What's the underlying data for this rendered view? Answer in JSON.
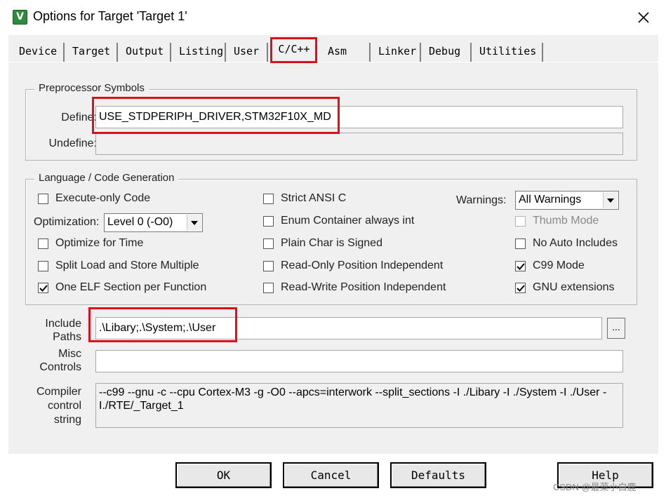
{
  "window": {
    "title": "Options for Target 'Target 1'",
    "icon_glyph": "V"
  },
  "tabs": [
    {
      "label": "Device"
    },
    {
      "label": "Target"
    },
    {
      "label": "Output"
    },
    {
      "label": "Listing"
    },
    {
      "label": "User"
    },
    {
      "label": "C/C++",
      "active": true
    },
    {
      "label": "Asm"
    },
    {
      "label": "Linker"
    },
    {
      "label": "Debug"
    },
    {
      "label": "Utilities"
    }
  ],
  "preprocessor": {
    "group_label": "Preprocessor Symbols",
    "define_label": "Define:",
    "define_value": "USE_STDPERIPH_DRIVER,STM32F10X_MD",
    "undefine_label": "Undefine:",
    "undefine_value": ""
  },
  "language": {
    "group_label": "Language / Code Generation",
    "execute_only": {
      "label": "Execute-only Code",
      "checked": false
    },
    "optimization_label": "Optimization:",
    "optimization_value": "Level 0 (-O0)",
    "optimize_time": {
      "label": "Optimize for Time",
      "checked": false
    },
    "split_load": {
      "label": "Split Load and Store Multiple",
      "checked": false
    },
    "one_elf": {
      "label": "One ELF Section per Function",
      "checked": true
    },
    "strict_ansi": {
      "label": "Strict ANSI C",
      "checked": false
    },
    "enum_int": {
      "label": "Enum Container always int",
      "checked": false
    },
    "plain_char": {
      "label": "Plain Char is Signed",
      "checked": false
    },
    "ro_pi": {
      "label": "Read-Only Position Independent",
      "checked": false
    },
    "rw_pi": {
      "label": "Read-Write Position Independent",
      "checked": false
    },
    "warnings_label": "Warnings:",
    "warnings_value": "All Warnings",
    "thumb_mode": {
      "label": "Thumb Mode",
      "checked": false,
      "disabled": true
    },
    "no_auto_includes": {
      "label": "No Auto Includes",
      "checked": false
    },
    "c99_mode": {
      "label": "C99 Mode",
      "checked": true
    },
    "gnu_ext": {
      "label": "GNU extensions",
      "checked": true
    }
  },
  "include_paths": {
    "label_line1": "Include",
    "label_line2": "Paths",
    "value": ".\\Libary;.\\System;.\\User",
    "browse_label": "..."
  },
  "misc_controls": {
    "label_line1": "Misc",
    "label_line2": "Controls",
    "value": ""
  },
  "compiler_string": {
    "label_line1": "Compiler",
    "label_line2": "control",
    "label_line3": "string",
    "value": "--c99 --gnu -c --cpu Cortex-M3 -g -O0 --apcs=interwork --split_sections -I ./Libary -I ./System -I ./User -I./RTE/_Target_1"
  },
  "buttons": {
    "ok": "OK",
    "cancel": "Cancel",
    "defaults": "Defaults",
    "help": "Help"
  },
  "watermark": "CSDN @最菜小白鹿"
}
